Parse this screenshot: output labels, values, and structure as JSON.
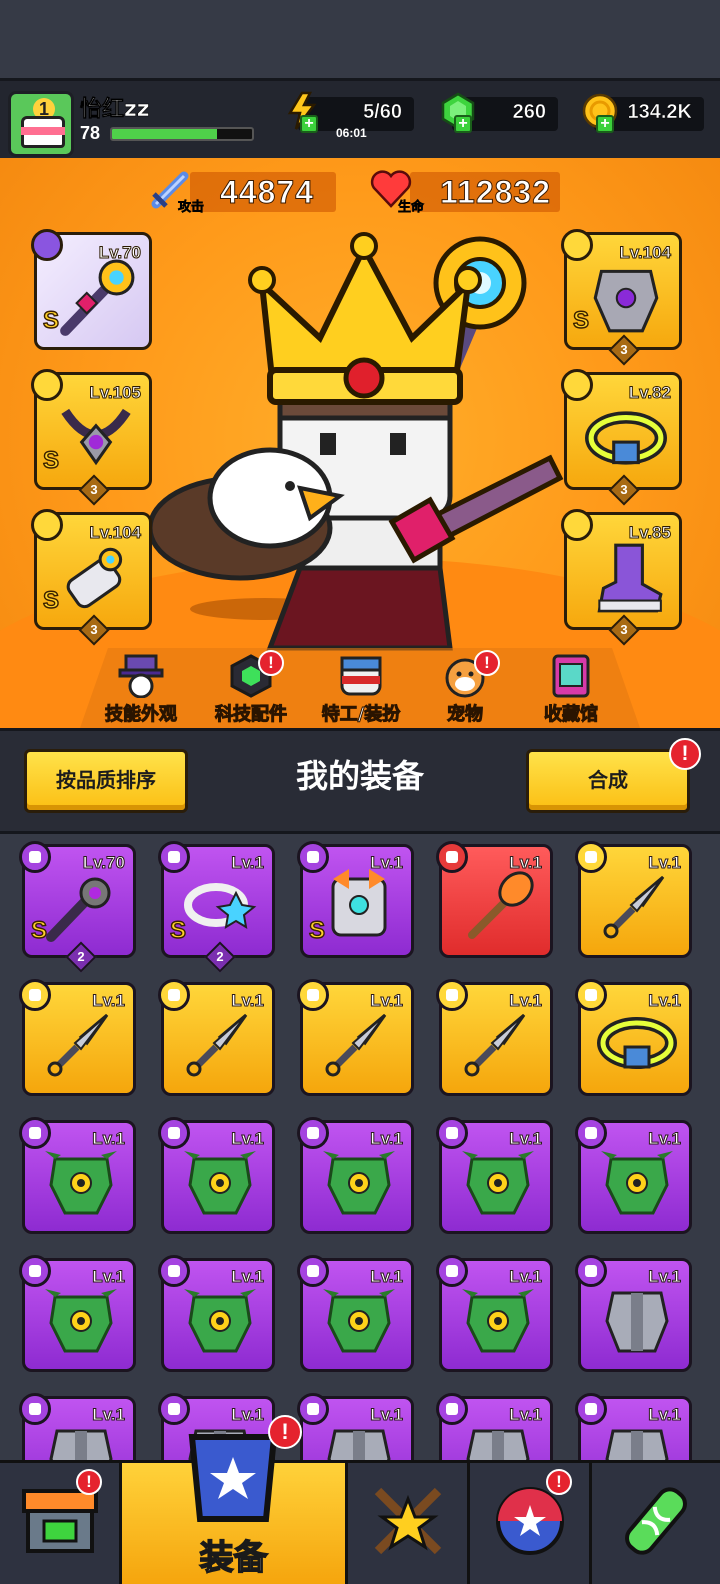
{
  "player": {
    "name": "怡红zz",
    "level": "78",
    "xp_fraction": 0.75,
    "avatar_level": "1"
  },
  "resources": {
    "energy": "5/60",
    "energy_timer": "06:01",
    "gems": "260",
    "gold": "134.2K"
  },
  "stats": {
    "attack_value": "44874",
    "attack_label": "攻击",
    "hp_value": "112832",
    "hp_label": "生命"
  },
  "equipped": [
    {
      "slot": "weapon",
      "level": "Lv.70",
      "grade": "S",
      "stars": ""
    },
    {
      "slot": "necklace",
      "level": "Lv.105",
      "grade": "S",
      "stars": "3"
    },
    {
      "slot": "gloves",
      "level": "Lv.104",
      "grade": "S",
      "stars": "3"
    },
    {
      "slot": "armor",
      "level": "Lv.104",
      "grade": "S",
      "stars": "3"
    },
    {
      "slot": "belt",
      "level": "Lv.82",
      "grade": "",
      "stars": "3"
    },
    {
      "slot": "boots",
      "level": "Lv.85",
      "grade": "",
      "stars": "3"
    }
  ],
  "hero_menu": [
    {
      "label": "技能外观",
      "alert": ""
    },
    {
      "label": "科技配件",
      "alert": "!"
    },
    {
      "label": "特工/装扮",
      "alert": ""
    },
    {
      "label": "宠物",
      "alert": "!"
    },
    {
      "label": "收藏馆",
      "alert": ""
    }
  ],
  "inventory_toolbar": {
    "sort_label": "按品质排序",
    "title": "我的装备",
    "merge_label": "合成",
    "merge_alert": "!"
  },
  "inventory": [
    {
      "level": "Lv.70",
      "rarity": "purple",
      "icon": "staff-icon",
      "grade": "S",
      "stars": "2"
    },
    {
      "level": "Lv.1",
      "rarity": "purple",
      "icon": "ring-icon",
      "grade": "S",
      "stars": "2"
    },
    {
      "level": "Lv.1",
      "rarity": "purple",
      "icon": "robot-armor-icon",
      "grade": "S",
      "stars": ""
    },
    {
      "level": "Lv.1",
      "rarity": "red",
      "icon": "torch-weapon-icon",
      "grade": "",
      "stars": ""
    },
    {
      "level": "Lv.1",
      "rarity": "yellow",
      "icon": "kunai-icon",
      "grade": "",
      "stars": ""
    },
    {
      "level": "Lv.1",
      "rarity": "yellow",
      "icon": "kunai-icon",
      "grade": "",
      "stars": ""
    },
    {
      "level": "Lv.1",
      "rarity": "yellow",
      "icon": "kunai-icon",
      "grade": "",
      "stars": ""
    },
    {
      "level": "Lv.1",
      "rarity": "yellow",
      "icon": "kunai-icon",
      "grade": "",
      "stars": ""
    },
    {
      "level": "Lv.1",
      "rarity": "yellow",
      "icon": "kunai-icon",
      "grade": "",
      "stars": ""
    },
    {
      "level": "Lv.1",
      "rarity": "yellow",
      "icon": "belt-icon",
      "grade": "",
      "stars": ""
    },
    {
      "level": "Lv.1",
      "rarity": "purple",
      "icon": "dragon-armor-icon",
      "grade": "",
      "stars": ""
    },
    {
      "level": "Lv.1",
      "rarity": "purple",
      "icon": "dragon-armor-icon",
      "grade": "",
      "stars": ""
    },
    {
      "level": "Lv.1",
      "rarity": "purple",
      "icon": "dragon-armor-icon",
      "grade": "",
      "stars": ""
    },
    {
      "level": "Lv.1",
      "rarity": "purple",
      "icon": "dragon-armor-icon",
      "grade": "",
      "stars": ""
    },
    {
      "level": "Lv.1",
      "rarity": "purple",
      "icon": "dragon-armor-icon",
      "grade": "",
      "stars": ""
    },
    {
      "level": "Lv.1",
      "rarity": "purple",
      "icon": "dragon-armor-icon",
      "grade": "",
      "stars": ""
    },
    {
      "level": "Lv.1",
      "rarity": "purple",
      "icon": "dragon-armor-icon",
      "grade": "",
      "stars": ""
    },
    {
      "level": "Lv.1",
      "rarity": "purple",
      "icon": "dragon-armor-icon",
      "grade": "",
      "stars": ""
    },
    {
      "level": "Lv.1",
      "rarity": "purple",
      "icon": "dragon-armor-icon",
      "grade": "",
      "stars": ""
    },
    {
      "level": "Lv.1",
      "rarity": "purple",
      "icon": "steel-armor-icon",
      "grade": "",
      "stars": ""
    },
    {
      "level": "Lv.1",
      "rarity": "purple",
      "icon": "steel-armor-icon",
      "grade": "",
      "stars": ""
    },
    {
      "level": "Lv.1",
      "rarity": "purple",
      "icon": "steel-armor-icon",
      "grade": "",
      "stars": ""
    },
    {
      "level": "Lv.1",
      "rarity": "purple",
      "icon": "steel-armor-icon",
      "grade": "",
      "stars": ""
    },
    {
      "level": "Lv.1",
      "rarity": "purple",
      "icon": "steel-armor-icon",
      "grade": "",
      "stars": ""
    },
    {
      "level": "Lv.1",
      "rarity": "purple",
      "icon": "steel-armor-icon",
      "grade": "",
      "stars": ""
    }
  ],
  "bottom_nav": {
    "shop_alert": "!",
    "equip_label": "装备",
    "equip_alert": "!",
    "events_alert": "!"
  },
  "colors": {
    "accent_yellow": "#fbbf13",
    "hero_orange": "#ff9a1a",
    "rarity_purple": "#a543e0",
    "rarity_yellow": "#ffd63a",
    "rarity_red": "#e02c2c",
    "alert_red": "#e5232e"
  }
}
